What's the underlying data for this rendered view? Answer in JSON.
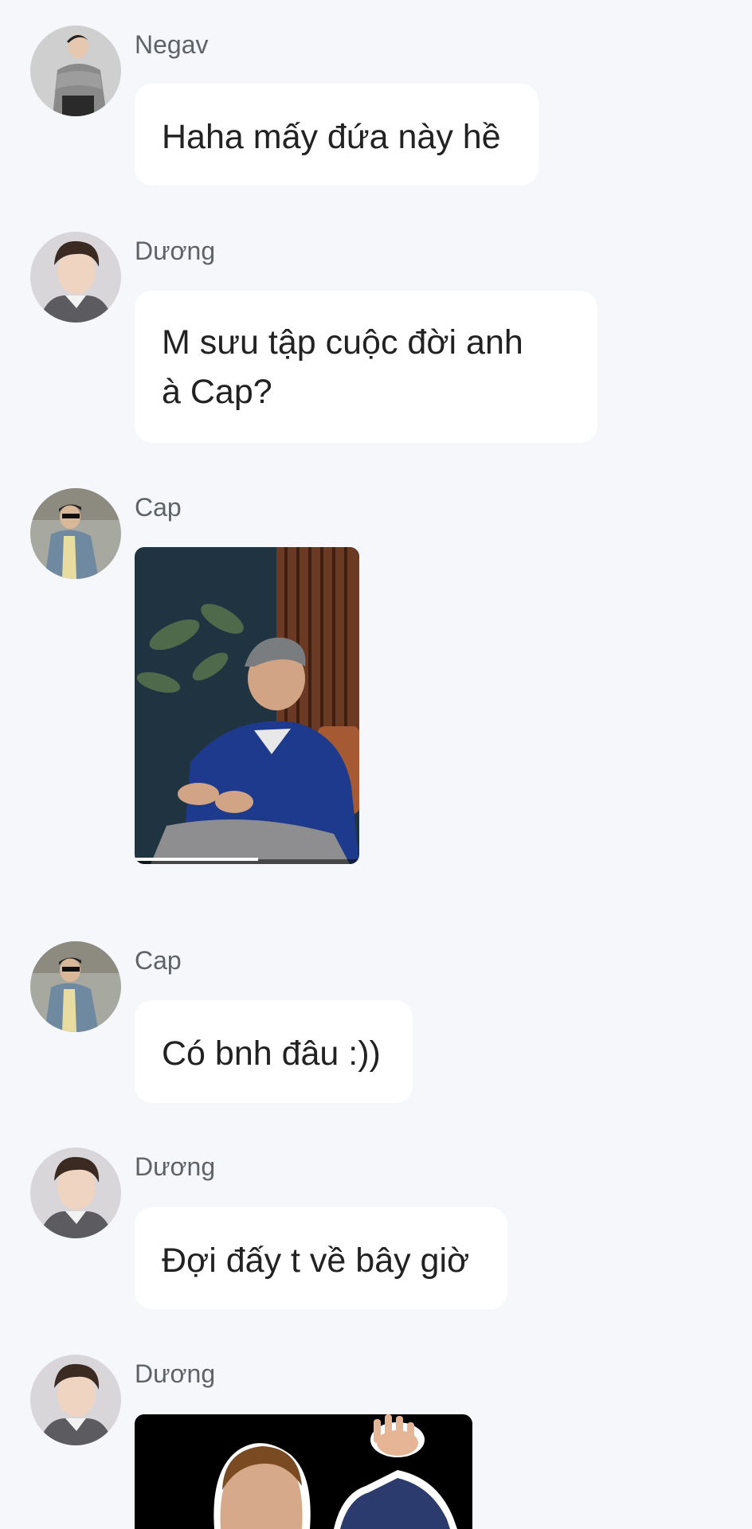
{
  "messages": [
    {
      "sender": "Negav",
      "avatar_icon": "avatar-negav",
      "type": "text",
      "text": "Haha mấy đứa này hề"
    },
    {
      "sender": "Dương",
      "avatar_icon": "avatar-duong",
      "type": "text",
      "lines": [
        "M sưu tập cuộc đời anh",
        "à Cap?"
      ]
    },
    {
      "sender": "Cap",
      "avatar_icon": "avatar-cap",
      "type": "video",
      "progress": 0.55
    },
    {
      "sender": "Cap",
      "avatar_icon": "avatar-cap",
      "type": "text",
      "text": "Có bnh đâu :))"
    },
    {
      "sender": "Dương",
      "avatar_icon": "avatar-duong",
      "type": "text",
      "text": "Đợi đấy t về bây giờ"
    },
    {
      "sender": "Dương",
      "avatar_icon": "avatar-duong",
      "type": "image"
    }
  ],
  "colors": {
    "background": "#f5f7fa",
    "bubble": "#ffffff",
    "sender_text": "#5f6368",
    "message_text": "#222222"
  }
}
